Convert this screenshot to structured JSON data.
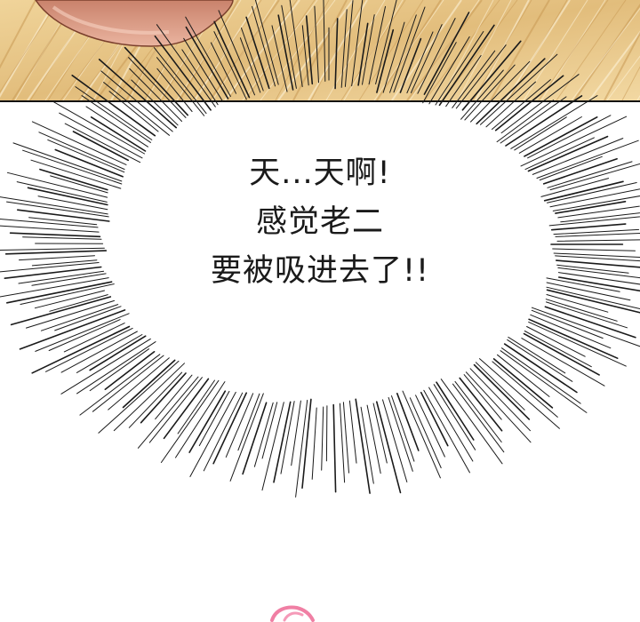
{
  "speech_bubble": {
    "lines": [
      "天...天啊!",
      "感觉老二",
      "要被吸进去了!!"
    ]
  },
  "colors": {
    "panel_background": "#e8c88a",
    "skin": "#d99a84",
    "speed_lines": "#1a1a1a",
    "bottom_mark": "#f07fa4"
  }
}
